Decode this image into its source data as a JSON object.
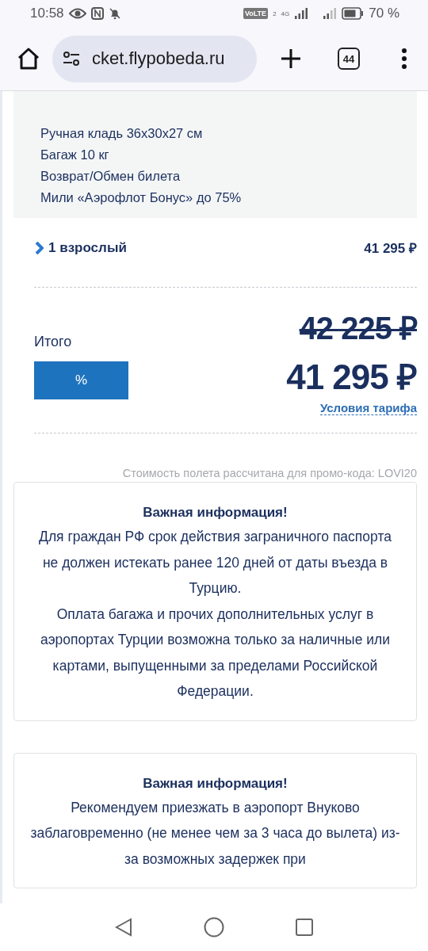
{
  "status_bar": {
    "time": "10:58",
    "volte": "VoLTE",
    "sim": "2",
    "network": "4G",
    "battery": "70 %"
  },
  "browser": {
    "url": "cket.flypobeda.ru",
    "tab_count": "44"
  },
  "fare": {
    "features": [
      "Ручная кладь 36x30x27 см",
      "Багаж 10 кг",
      "Возврат/Обмен билета",
      "Мили «Аэрофлот Бонус» до 75%"
    ]
  },
  "passengers": {
    "label": "1 взрослый",
    "price": "41 295 ₽",
    "expanded": false
  },
  "total": {
    "label": "Итого",
    "promo_button": "%",
    "old_price": "42 225 ₽",
    "price": "41 295 ₽",
    "conditions_link": "Условия тарифа"
  },
  "promo_note": "Стоимость полета рассчитана для промо-кода: LOVI20",
  "info_cards": [
    {
      "title": "Важная информация!",
      "paragraphs": [
        "Для граждан РФ срок действия заграничного паспорта не должен истекать ранее 120 дней от даты въезда в Турцию.",
        "Оплата багажа и прочих дополнительных услуг в аэропортах Турции возможна только за наличные или картами, выпущенными за пределами Российской Федерации."
      ]
    },
    {
      "title": "Важная информация!",
      "paragraphs": [
        "Рекомендуем приезжать в аэропорт Внуково заблаговременно (не менее чем за 3 часа до вылета) из-за возможных задержек при"
      ]
    }
  ]
}
